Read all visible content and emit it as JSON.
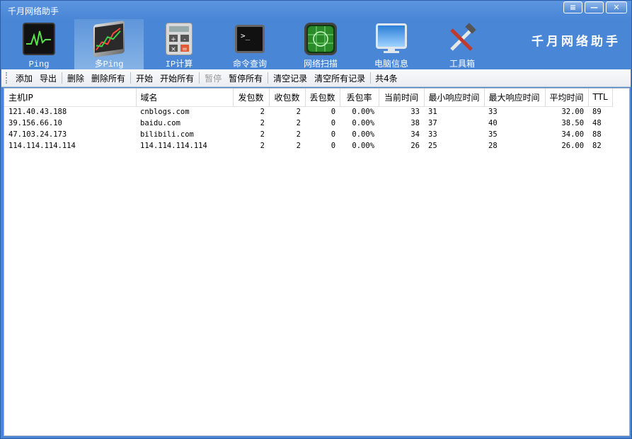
{
  "window": {
    "title": "千月网络助手",
    "controls": {
      "menu": "≡",
      "minimize": "—",
      "close": "✕"
    }
  },
  "navbar": {
    "brand": "千月网络助手",
    "items": [
      {
        "label": "Ping",
        "icon": "ping-monitor-icon"
      },
      {
        "label": "多Ping",
        "icon": "multi-chart-icon",
        "active": true
      },
      {
        "label": "IP计算",
        "icon": "calculator-icon"
      },
      {
        "label": "命令查询",
        "icon": "terminal-icon"
      },
      {
        "label": "网络扫描",
        "icon": "radar-scan-icon"
      },
      {
        "label": "电脑信息",
        "icon": "monitor-pc-icon"
      },
      {
        "label": "工具箱",
        "icon": "tools-icon"
      }
    ]
  },
  "toolbar": {
    "add": "添加",
    "export": "导出",
    "delete": "删除",
    "delete_all": "删除所有",
    "start": "开始",
    "start_all": "开始所有",
    "pause": "暂停",
    "pause_all": "暂停所有",
    "clear_log": "清空记录",
    "clear_all_log": "清空所有记录",
    "count": "共4条"
  },
  "table": {
    "columns": [
      "主机IP",
      "域名",
      "发包数",
      "收包数",
      "丢包数",
      "丢包率",
      "当前时间",
      "最小响应时间",
      "最大响应时间",
      "平均时间",
      "TTL"
    ],
    "rows": [
      [
        "121.40.43.188",
        "cnblogs.com",
        "2",
        "2",
        "0",
        "0.00%",
        "33",
        "31",
        "33",
        "32.00",
        "89"
      ],
      [
        "39.156.66.10",
        "baidu.com",
        "2",
        "2",
        "0",
        "0.00%",
        "38",
        "37",
        "40",
        "38.50",
        "48"
      ],
      [
        "47.103.24.173",
        "bilibili.com",
        "2",
        "2",
        "0",
        "0.00%",
        "34",
        "33",
        "35",
        "34.00",
        "88"
      ],
      [
        "114.114.114.114",
        "114.114.114.114",
        "2",
        "2",
        "0",
        "0.00%",
        "26",
        "25",
        "28",
        "26.00",
        "82"
      ]
    ]
  },
  "colors": {
    "window_blue": "#4a86d6",
    "active_tab": "#86b3e6"
  }
}
